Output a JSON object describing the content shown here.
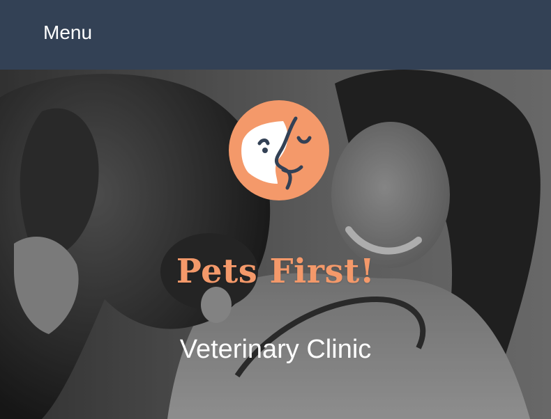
{
  "header": {
    "menu_label": "Menu"
  },
  "hero": {
    "brand_name": "Pets First!",
    "tagline": "Veterinary Clinic",
    "photo_subject": "veterinarian hugging a dog"
  },
  "colors": {
    "header_bg": "#334155",
    "accent": "#F4996A",
    "logo_face": "#FFFFFF",
    "logo_line": "#334155",
    "text_light": "#FFFFFF"
  },
  "icons": {
    "logo": "pet-human-face-logo"
  }
}
